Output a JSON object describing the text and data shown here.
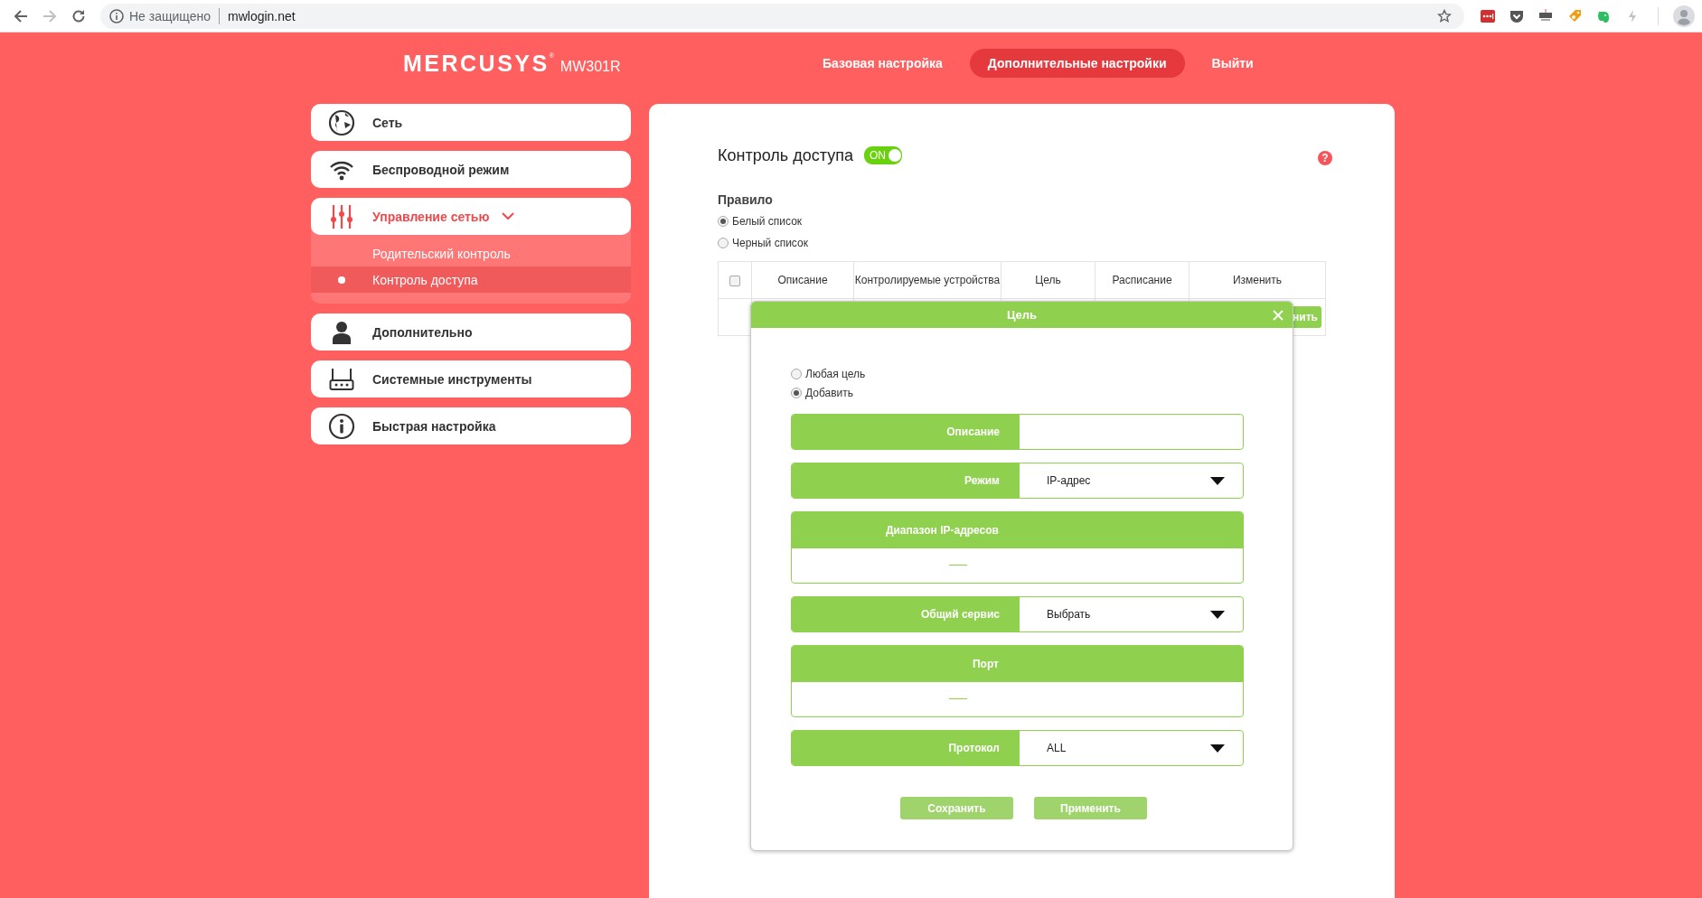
{
  "browser": {
    "security_label": "Не защищено",
    "url": "mwlogin.net"
  },
  "header": {
    "brand": "MERCUSYS",
    "brand_mark": "®",
    "model": "MW301R",
    "nav": [
      {
        "label": "Базовая настройка",
        "selected": false
      },
      {
        "label": "Дополнительные настройки",
        "selected": true
      },
      {
        "label": "Выйти",
        "selected": false
      }
    ]
  },
  "sidebar": {
    "items": [
      {
        "label": "Сеть",
        "expanded": false
      },
      {
        "label": "Беспроводной режим",
        "expanded": false
      },
      {
        "label": "Управление сетью",
        "expanded": true,
        "children": [
          {
            "label": "Родительский контроль",
            "selected": false
          },
          {
            "label": "Контроль доступа",
            "selected": true
          }
        ]
      },
      {
        "label": "Дополнительно",
        "expanded": false
      },
      {
        "label": "Системные инструменты",
        "expanded": false
      },
      {
        "label": "Быстрая настройка",
        "expanded": false
      }
    ]
  },
  "main": {
    "title": "Контроль доступа",
    "toggle": {
      "label": "ON",
      "on": true
    },
    "help": "?",
    "rule": {
      "label": "Правило",
      "options": [
        {
          "label": "Белый список",
          "selected": true
        },
        {
          "label": "Черный список",
          "selected": false
        }
      ]
    },
    "table": {
      "select_all": {
        "checked": false
      },
      "columns": [
        "Описание",
        "Контролируемые устройства",
        "Цель",
        "Расписание",
        "Изменить"
      ],
      "row_button": "нить"
    }
  },
  "dialog": {
    "title": "Цель",
    "options": [
      {
        "label": "Любая цель",
        "selected": false
      },
      {
        "label": "Добавить",
        "selected": true
      }
    ],
    "fields": [
      {
        "kind": "text",
        "label": "Описание"
      },
      {
        "kind": "select",
        "label": "Режим",
        "value": "IP-адрес"
      },
      {
        "kind": "range",
        "label": "Диапазон IP-адресов"
      },
      {
        "kind": "select",
        "label": "Общий сервис",
        "value": "Выбрать"
      },
      {
        "kind": "range",
        "label": "Порт"
      },
      {
        "kind": "select",
        "label": "Протокол",
        "value": "ALL"
      }
    ],
    "buttons": [
      "Сохранить",
      "Применить"
    ]
  }
}
